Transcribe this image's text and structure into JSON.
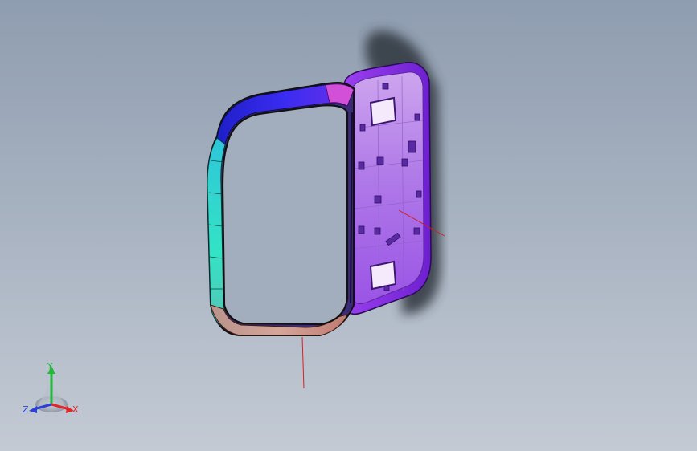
{
  "triad": {
    "x_label": "X",
    "y_label": "Y",
    "z_label": "Z",
    "colors": {
      "x": "#e0262a",
      "y": "#22b83a",
      "z": "#2a3fd6"
    }
  },
  "model": {
    "colors": {
      "top_band": "#2f26e8",
      "left_band": "#2fe2c8",
      "bottom_band": "#c98a7e",
      "panel": "#b47ce8",
      "panel_dark": "#8a3fe0",
      "shadow": "#3a3f47",
      "annotation_line": "#d32020"
    }
  }
}
